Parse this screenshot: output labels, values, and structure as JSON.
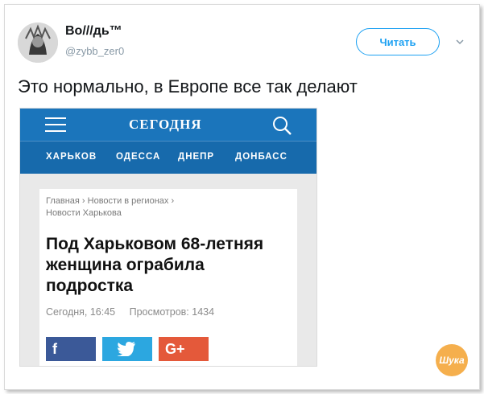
{
  "tweet": {
    "author_name": "Во///дь™",
    "author_handle": "@zybb_zer0",
    "follow_label": "Читать",
    "text": "Это нормально, в Европе все так делают"
  },
  "site": {
    "brand": "СЕГОДНЯ",
    "cities": [
      "ХАРЬКОВ",
      "ОДЕССА",
      "ДНЕПР",
      "ДОНБАСС"
    ],
    "breadcrumb_line1": "Главная › Новости в регионах ›",
    "breadcrumb_line2": "Новости Харькова",
    "headline": "Под Харьковом 68-летняя женщина ограбила подростка",
    "meta_time": "Сегодня, 16:45",
    "meta_views": "Просмотров: 1434",
    "share_fb": "f",
    "share_gp": "G+"
  },
  "watermark": {
    "text": "Шука"
  },
  "colors": {
    "twitter_blue": "#1da1f2",
    "site_bar": "#1b75bb",
    "facebook": "#3b5998",
    "twitter_share": "#2ca7e0",
    "gplus": "#e4593a"
  },
  "icons": [
    "avatar",
    "chevron-down-icon",
    "hamburger-menu-icon",
    "search-icon",
    "twitter-bird-icon"
  ]
}
